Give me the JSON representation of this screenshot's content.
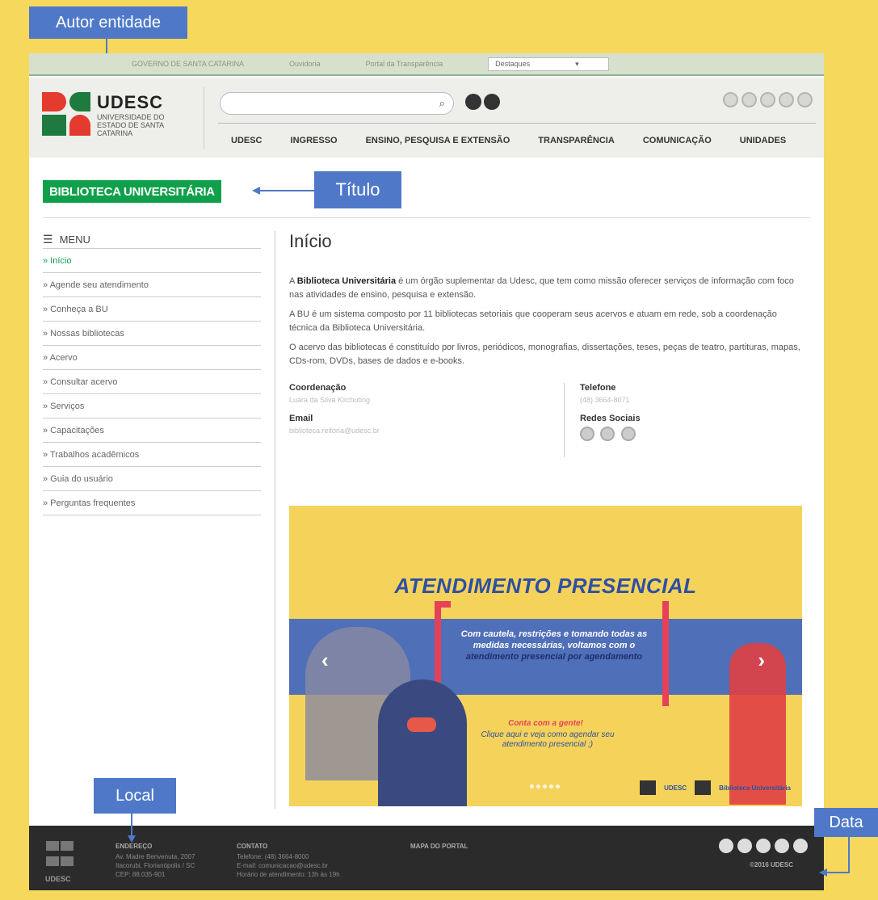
{
  "annotations": {
    "autor": "Autor entidade",
    "titulo": "Título",
    "local": "Local",
    "data": "Data"
  },
  "topbar": {
    "links": [
      "GOVERNO DE SANTA CATARINA",
      "Ouvidoria",
      "Portal da Transparência"
    ],
    "select_value": "Destaques"
  },
  "header": {
    "logo_name": "UDESC",
    "logo_sub": "UNIVERSIDADE DO ESTADO DE SANTA CATARINA",
    "nav": [
      "UDESC",
      "INGRESSO",
      "ENSINO, PESQUISA E EXTENSÃO",
      "TRANSPARÊNCIA",
      "COMUNICAÇÃO",
      "UNIDADES"
    ]
  },
  "page_title": "BIBLIOTECA UNIVERSITÁRIA",
  "sidebar": {
    "menu_label": "MENU",
    "items": [
      "» Início",
      "» Agende seu atendimento",
      "» Conheça a BU",
      "» Nossas bibliotecas",
      "» Acervo",
      "» Consultar acervo",
      "» Serviços",
      "» Capacitações",
      "» Trabalhos acadêmicos",
      "» Guia do usuário",
      "» Perguntas frequentes"
    ]
  },
  "main": {
    "heading": "Início",
    "p1_bold": "Biblioteca Universitária",
    "p1_pre": "A ",
    "p1_post": " é um órgão suplementar da Udesc, que tem como missão oferecer serviços de informação com foco nas atividades de ensino, pesquisa e extensão.",
    "p2": "A BU é um sistema composto por 11 bibliotecas setoriais que cooperam seus acervos e atuam em rede, sob a coordenação técnica da Biblioteca Universitária.",
    "p3": "O acervo das bibliotecas é constituído por livros, periódicos, monografias, dissertações, teses, peças de teatro, partituras, mapas, CDs-rom, DVDs, bases de dados e e-books."
  },
  "contact": {
    "coord_label": "Coordenação",
    "coord_value": "Luara da Silva Kirchuting",
    "email_label": "Email",
    "email_value": "biblioteca.reitoria@udesc.br",
    "phone_label": "Telefone",
    "phone_value": "(48) 3664-8071",
    "social_label": "Redes Sociais"
  },
  "banner": {
    "heading": "ATENDIMENTO PRESENCIAL",
    "text_main": "Com cautela, restrições e tomando todas as medidas necessárias, voltamos com o ",
    "text_highlight": "atendimento presencial por agendamento",
    "call1": "Conta com a gente!",
    "call2": "Clique aqui e veja como agendar seu atendimento presencial ;)",
    "logo1": "UDESC",
    "logo2": "Biblioteca Universitária"
  },
  "footer": {
    "logo": "UDESC",
    "address_head": "ENDEREÇO",
    "address_lines": [
      "Av. Madre Benvenuta, 2007",
      "Itacorubi, Florianópolis / SC",
      "CEP: 88.035-901"
    ],
    "contact_head": "CONTATO",
    "contact_lines": [
      "Telefone: (48) 3664-8000",
      "E-mail: comunicacao@udesc.br",
      "Horário de atendimento: 13h às 19h"
    ],
    "map_head": "MAPA DO PORTAL",
    "copyright": "©2016 UDESC"
  }
}
